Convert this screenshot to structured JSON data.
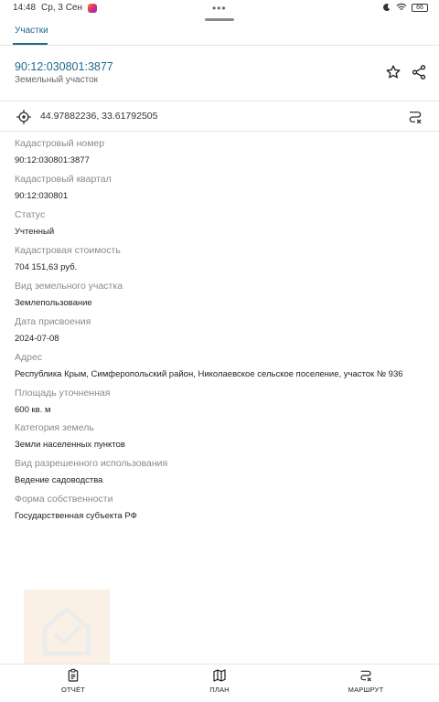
{
  "statusbar": {
    "time": "14:48",
    "date": "Ср, 3 Сен",
    "center_dots": "•••",
    "battery": "66"
  },
  "tabs": [
    {
      "label": "Участки"
    }
  ],
  "header": {
    "cadastral_number": "90:12:030801:3877",
    "object_type": "Земельный участок"
  },
  "coords": {
    "text": "44.97882236, 33.61792505"
  },
  "fields": [
    {
      "label": "Кадастровый номер",
      "value": "90:12:030801:3877"
    },
    {
      "label": "Кадастровый квартал",
      "value": "90:12:030801"
    },
    {
      "label": "Статус",
      "value": "Учтенный"
    },
    {
      "label": "Кадастровая стоимость",
      "value": "704 151,63 руб."
    },
    {
      "label": "Вид земельного участка",
      "value": "Землепользование"
    },
    {
      "label": "Дата присвоения",
      "value": "2024-07-08"
    },
    {
      "label": "Адрес",
      "value": "Республика Крым, Симферопольский район, Николаевское сельское поселение, участок № 936"
    },
    {
      "label": "Площадь уточненная",
      "value": "600 кв. м"
    },
    {
      "label": "Категория земель",
      "value": "Земли населенных пунктов"
    },
    {
      "label": "Вид разрешенного использования",
      "value": "Ведение садоводства"
    },
    {
      "label": "Форма собственности",
      "value": "Государственная субъекта РФ"
    }
  ],
  "bottom_nav": [
    {
      "label": "ОТЧЁТ",
      "icon": "report-icon"
    },
    {
      "label": "ПЛАН",
      "icon": "map-icon"
    },
    {
      "label": "МАРШРУТ",
      "icon": "route-icon"
    }
  ],
  "colors": {
    "accent": "#1c6a8a",
    "label_gray": "#8a8a8a",
    "divider": "#e6e6e6"
  }
}
